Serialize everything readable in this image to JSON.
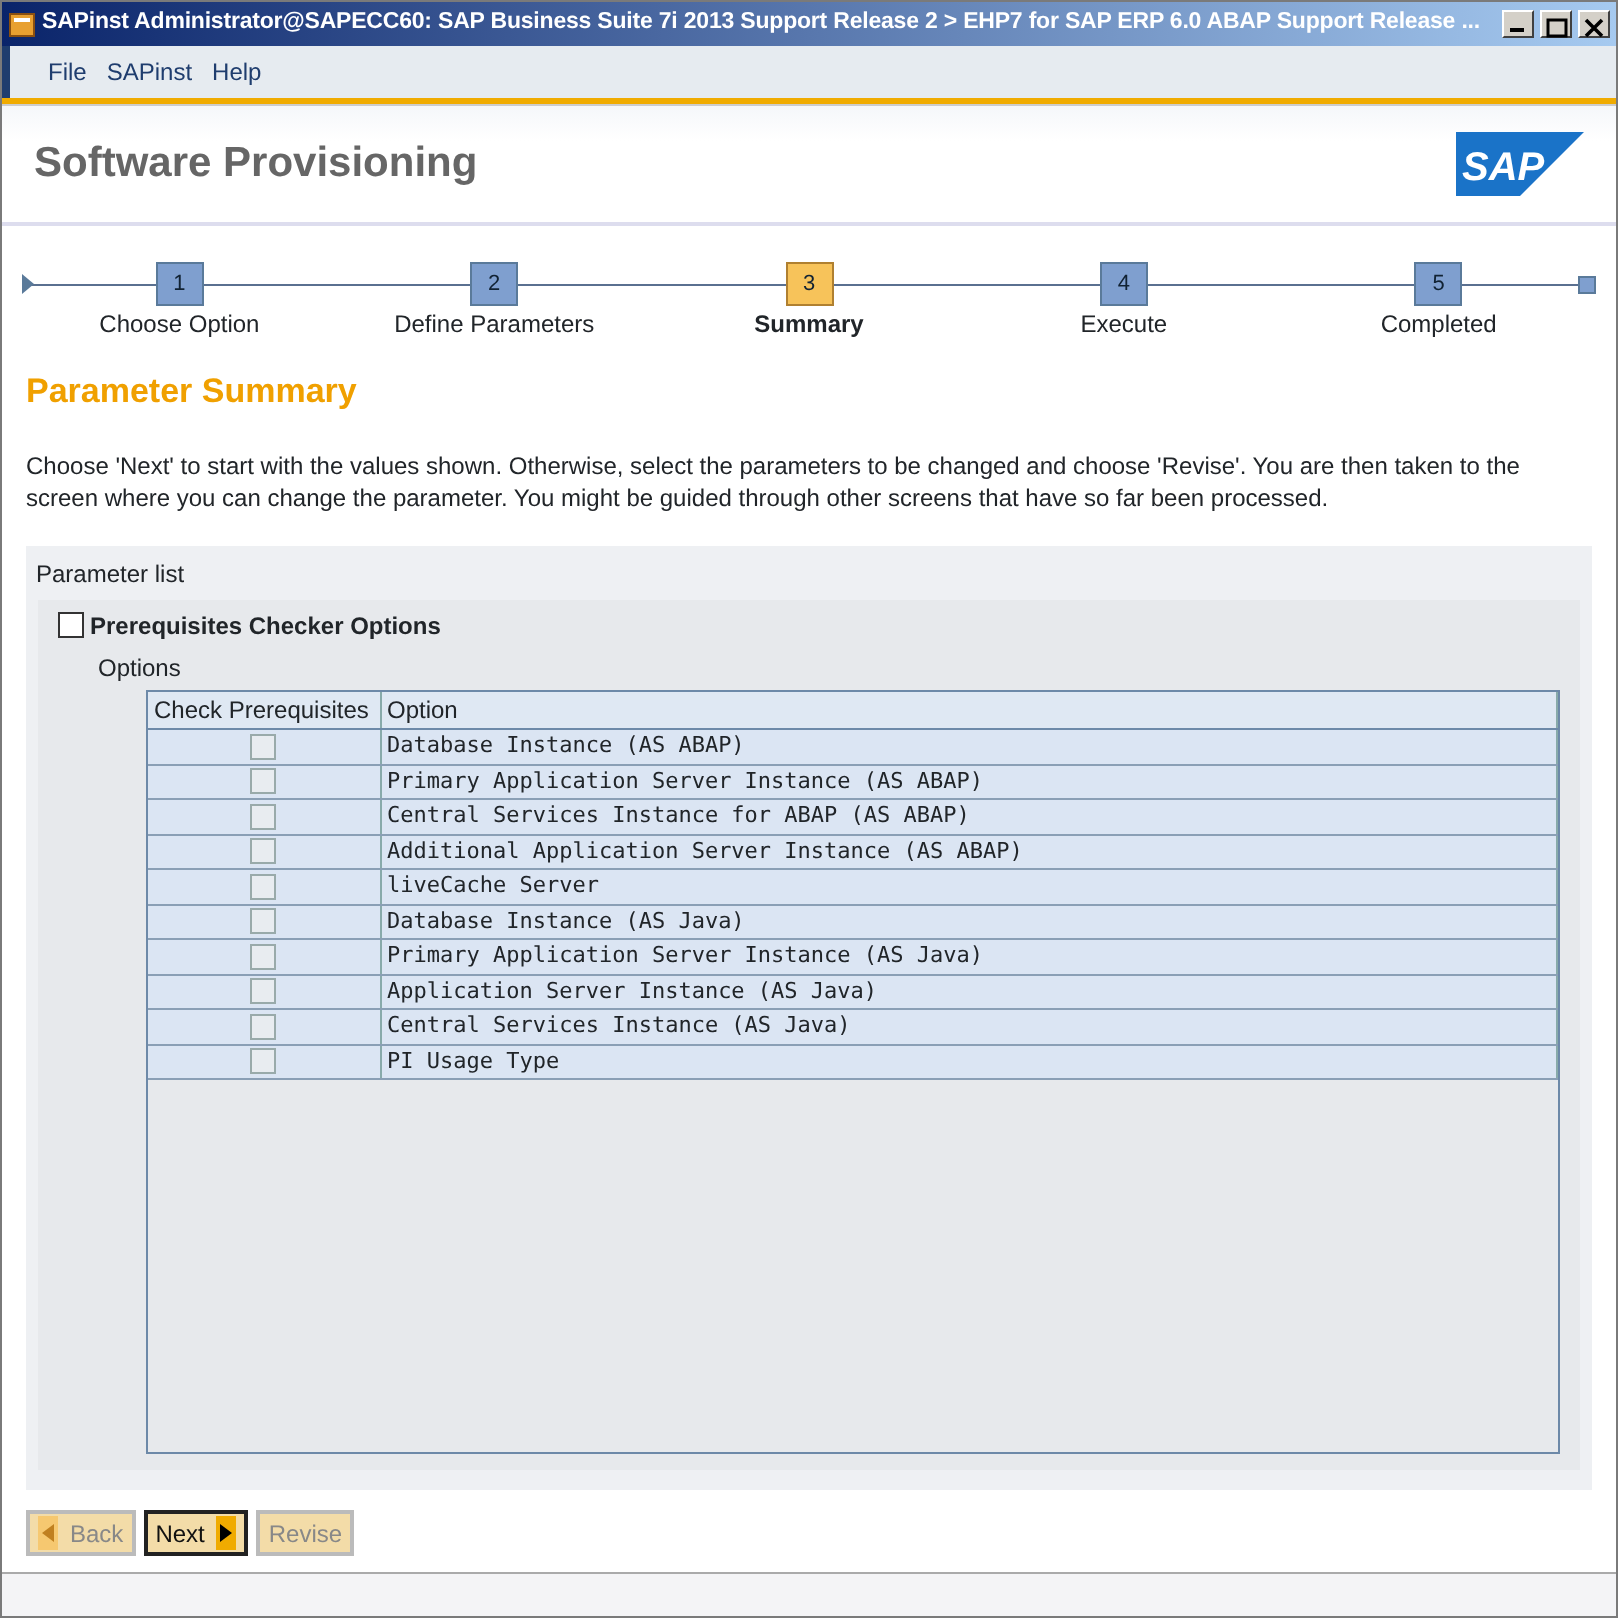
{
  "window": {
    "title": "SAPinst Administrator@SAPECC60: SAP Business Suite 7i 2013 Support Release 2 > EHP7 for SAP ERP 6.0 ABAP Support Release ..."
  },
  "menu": [
    "File",
    "SAPinst",
    "Help"
  ],
  "header": {
    "title": "Software Provisioning",
    "logo": "SAP"
  },
  "steps": [
    {
      "number": "1",
      "label": "Choose Option",
      "selected": false
    },
    {
      "number": "2",
      "label": "Define Parameters",
      "selected": false
    },
    {
      "number": "3",
      "label": "Summary",
      "selected": true
    },
    {
      "number": "4",
      "label": "Execute",
      "selected": false
    },
    {
      "number": "5",
      "label": "Completed",
      "selected": false
    }
  ],
  "heading": "Parameter Summary",
  "description": "Choose 'Next' to start with the values shown. Otherwise, select the parameters to be changed and choose 'Revise'. You are then taken to the screen where you can change the parameter. You might be guided through other screens that have so far been processed.",
  "parameter_list": {
    "title": "Parameter list",
    "group": {
      "label": "Prerequisites Checker Options",
      "checked": false,
      "options_label": "Options",
      "table": {
        "columns": [
          "Check Prerequisites",
          "Option"
        ],
        "rows": [
          {
            "checked": false,
            "disabled": true,
            "option": "Database Instance (AS ABAP)"
          },
          {
            "checked": false,
            "disabled": true,
            "option": "Primary Application Server Instance (AS ABAP)"
          },
          {
            "checked": false,
            "disabled": true,
            "option": "Central Services Instance for ABAP (AS ABAP)"
          },
          {
            "checked": false,
            "disabled": true,
            "option": "Additional Application Server Instance (AS ABAP)"
          },
          {
            "checked": false,
            "disabled": true,
            "option": "liveCache Server"
          },
          {
            "checked": false,
            "disabled": true,
            "option": "Database Instance (AS Java)"
          },
          {
            "checked": false,
            "disabled": true,
            "option": "Primary Application Server Instance (AS Java)"
          },
          {
            "checked": false,
            "disabled": true,
            "option": "Application Server Instance (AS Java)"
          },
          {
            "checked": false,
            "disabled": true,
            "option": "Central Services Instance (AS Java)"
          },
          {
            "checked": false,
            "disabled": true,
            "option": "PI Usage Type"
          }
        ]
      }
    }
  },
  "buttons": [
    {
      "label": "Back",
      "kind": "back",
      "disabled": true,
      "default": false
    },
    {
      "label": "Next",
      "kind": "next",
      "disabled": false,
      "default": true
    },
    {
      "label": "Revise",
      "kind": "plain",
      "disabled": true,
      "default": false
    }
  ]
}
